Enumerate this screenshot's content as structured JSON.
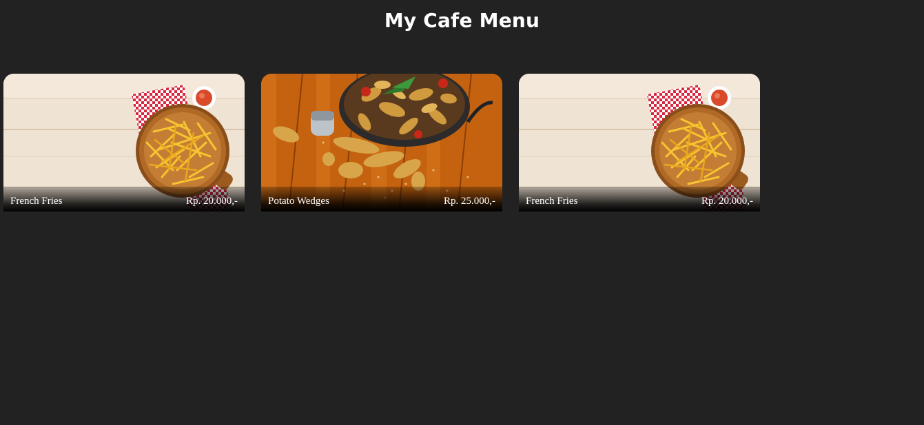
{
  "page": {
    "title": "My Cafe Menu",
    "background": "#222222",
    "text_color": "#ffffff"
  },
  "menu": {
    "items": [
      {
        "name": "French Fries",
        "price": "Rp. 20.000,-",
        "photo": "french-fries-photo"
      },
      {
        "name": "Potato Wedges",
        "price": "Rp. 25.000,-",
        "photo": "potato-wedges-photo"
      },
      {
        "name": "French Fries",
        "price": "Rp. 20.000,-",
        "photo": "french-fries-photo"
      }
    ]
  }
}
